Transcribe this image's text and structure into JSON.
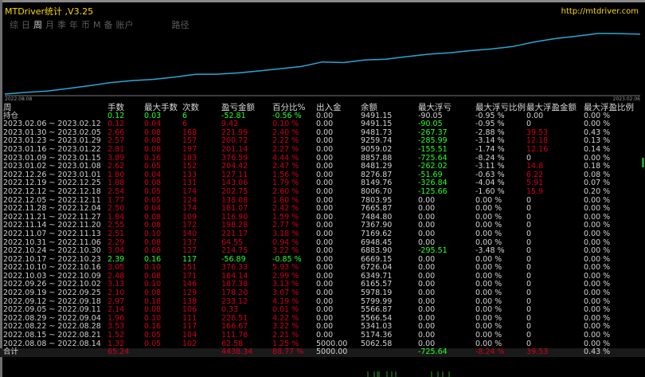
{
  "header": {
    "title": "MTDriver统计 ,V3.25",
    "url": "http://mtdriver.com"
  },
  "tabs": [
    {
      "label": "综",
      "selected": false
    },
    {
      "label": "日",
      "selected": false
    },
    {
      "label": "周",
      "selected": true
    },
    {
      "label": "月",
      "selected": false
    },
    {
      "label": "季",
      "selected": false
    },
    {
      "label": "年",
      "selected": false
    },
    {
      "label": "币",
      "selected": false
    },
    {
      "label": "M",
      "selected": false
    },
    {
      "label": "备",
      "selected": false
    },
    {
      "label": "账户",
      "selected": false
    },
    {
      "label": "路径",
      "selected": false
    }
  ],
  "chart_data": {
    "type": "line",
    "x_start_label": "2022.08.08",
    "x_end_label": "2023.02.06",
    "series": [
      {
        "values": [
          62.58,
          203.07,
          305.24,
          524.59,
          759.4,
          1015.48,
          1180.17,
          1282.75,
          1476.03,
          1709.15,
          1709.48,
          1815.48,
          1985.9,
          2172.57,
          2357.71,
          2734.04,
          2677.15,
          2891.9,
          2956.45,
          3177.62,
          3376.82,
          3493.72,
          3674.79,
          3812.88,
          4017.3,
          4394.89,
          4676.03,
          4876.75,
          5098.74,
          5093.99,
          5036.94
        ]
      }
    ],
    "color": "#2aa7d6",
    "grid": false
  },
  "table": {
    "columns": [
      "周",
      "手数",
      "最大手数",
      "次数",
      "盈亏金额",
      "百分比%",
      "出入金",
      "余额",
      "最大浮亏",
      "最大浮亏比例",
      "最大浮盈金额",
      "最大浮盈比例"
    ],
    "holding": {
      "label": "持仓",
      "lots": "0.12",
      "max_lots": "0.03",
      "count": "6",
      "pnl": "-52.81",
      "pct": "-0.56 %",
      "deposit": "0.00",
      "balance": "9491.15",
      "max_float_loss": "-90.05",
      "max_float_loss_pct": "-0.95 %",
      "max_float_profit": "0.00",
      "max_float_profit_pct": "0.00 %"
    },
    "rows": [
      {
        "week": "2023.02.06 ~ 2023.02.12",
        "lots": "0.12",
        "max_lots": "0.04",
        "count": "6",
        "pnl": "9.42",
        "pct": "0.10 %",
        "deposit": "0.00",
        "balance": "9491.15",
        "max_float_loss": "-90.05",
        "max_float_loss_pct": "-0.95 %",
        "max_float_profit": "0",
        "max_float_profit_pct": "0.00 %"
      },
      {
        "week": "2023.01.30 ~ 2023.02.05",
        "lots": "2.66",
        "max_lots": "0.08",
        "count": "168",
        "pnl": "221.99",
        "pct": "2.40 %",
        "deposit": "0.00",
        "balance": "9481.73",
        "max_float_loss": "-267.37",
        "max_float_loss_pct": "-2.88 %",
        "max_float_profit": "39.53",
        "max_float_profit_pct": "0.43 %"
      },
      {
        "week": "2023.01.23 ~ 2023.01.29",
        "lots": "2.57",
        "max_lots": "0.08",
        "count": "157",
        "pnl": "200.72",
        "pct": "2.22 %",
        "deposit": "0.00",
        "balance": "9259.74",
        "max_float_loss": "-285.99",
        "max_float_loss_pct": "-3.14 %",
        "max_float_profit": "12.18",
        "max_float_profit_pct": "0.13 %"
      },
      {
        "week": "2023.01.16 ~ 2023.01.22",
        "lots": "2.81",
        "max_lots": "0.08",
        "count": "197",
        "pnl": "201.14",
        "pct": "2.27 %",
        "deposit": "0.00",
        "balance": "9059.02",
        "max_float_loss": "-155.51",
        "max_float_loss_pct": "-1.74 %",
        "max_float_profit": "12.16",
        "max_float_profit_pct": "0.14 %"
      },
      {
        "week": "2023.01.09 ~ 2023.01.15",
        "lots": "3.89",
        "max_lots": "0.16",
        "count": "183",
        "pnl": "376.59",
        "pct": "4.44 %",
        "deposit": "0.00",
        "balance": "8857.88",
        "max_float_loss": "-725.64",
        "max_float_loss_pct": "-8.24 %",
        "max_float_profit": "0",
        "max_float_profit_pct": "0.00 %"
      },
      {
        "week": "2023.01.02 ~ 2023.01.08",
        "lots": "2.62",
        "max_lots": "0.05",
        "count": "152",
        "pnl": "204.42",
        "pct": "2.47 %",
        "deposit": "0.00",
        "balance": "8481.29",
        "max_float_loss": "-262.02",
        "max_float_loss_pct": "-3.11 %",
        "max_float_profit": "14.8",
        "max_float_profit_pct": "0.18 %"
      },
      {
        "week": "2022.12.26 ~ 2023.01.01",
        "lots": "1.80",
        "max_lots": "0.04",
        "count": "133",
        "pnl": "127.11",
        "pct": "1.56 %",
        "deposit": "0.00",
        "balance": "8276.87",
        "max_float_loss": "-51.69",
        "max_float_loss_pct": "-0.63 %",
        "max_float_profit": "6.22",
        "max_float_profit_pct": "0.08 %"
      },
      {
        "week": "2022.12.19 ~ 2022.12.25",
        "lots": "1.88",
        "max_lots": "0.08",
        "count": "131",
        "pnl": "143.06",
        "pct": "1.79 %",
        "deposit": "0.00",
        "balance": "8149.76",
        "max_float_loss": "-326.84",
        "max_float_loss_pct": "-4.04 %",
        "max_float_profit": "5.91",
        "max_float_profit_pct": "0.07 %"
      },
      {
        "week": "2022.12.12 ~ 2022.12.18",
        "lots": "2.54",
        "max_lots": "0.05",
        "count": "174",
        "pnl": "202.75",
        "pct": "2.60 %",
        "deposit": "0.00",
        "balance": "8006.70",
        "max_float_loss": "-125.66",
        "max_float_loss_pct": "-1.60 %",
        "max_float_profit": "15.9",
        "max_float_profit_pct": "0.20 %"
      },
      {
        "week": "2022.12.05 ~ 2022.12.11",
        "lots": "1.77",
        "max_lots": "0.05",
        "count": "124",
        "pnl": "138.08",
        "pct": "1.80 %",
        "deposit": "0.00",
        "balance": "7803.95",
        "max_float_loss": "0.00",
        "max_float_loss_pct": "0.00 %",
        "max_float_profit": "0",
        "max_float_profit_pct": "0.00 %"
      },
      {
        "week": "2022.11.28 ~ 2022.12.04",
        "lots": "2.50",
        "max_lots": "0.04",
        "count": "174",
        "pnl": "181.07",
        "pct": "2.42 %",
        "deposit": "0.00",
        "balance": "7665.87",
        "max_float_loss": "0.00",
        "max_float_loss_pct": "0.00 %",
        "max_float_profit": "0",
        "max_float_profit_pct": "0.00 %"
      },
      {
        "week": "2022.11.21 ~ 2022.11.27",
        "lots": "1.84",
        "max_lots": "0.08",
        "count": "109",
        "pnl": "116.90",
        "pct": "1.59 %",
        "deposit": "0.00",
        "balance": "7484.80",
        "max_float_loss": "0.00",
        "max_float_loss_pct": "0.00 %",
        "max_float_profit": "0",
        "max_float_profit_pct": "0.00 %"
      },
      {
        "week": "2022.11.14 ~ 2022.11.20",
        "lots": "2.55",
        "max_lots": "0.08",
        "count": "172",
        "pnl": "198.28",
        "pct": "2.77 %",
        "deposit": "0.00",
        "balance": "7367.90",
        "max_float_loss": "0.00",
        "max_float_loss_pct": "0.00 %",
        "max_float_profit": "0",
        "max_float_profit_pct": "0.00 %"
      },
      {
        "week": "2022.11.07 ~ 2022.11.13",
        "lots": "2.51",
        "max_lots": "0.10",
        "count": "140",
        "pnl": "221.17",
        "pct": "3.18 %",
        "deposit": "0.00",
        "balance": "7169.62",
        "max_float_loss": "0.00",
        "max_float_loss_pct": "0.00 %",
        "max_float_profit": "0",
        "max_float_profit_pct": "0.00 %"
      },
      {
        "week": "2022.10.31 ~ 2022.11.06",
        "lots": "2.29",
        "max_lots": "0.08",
        "count": "137",
        "pnl": "64.55",
        "pct": "0.94 %",
        "deposit": "0.00",
        "balance": "6948.45",
        "max_float_loss": "0.00",
        "max_float_loss_pct": "0.00 %",
        "max_float_profit": "0",
        "max_float_profit_pct": "0.00 %"
      },
      {
        "week": "2022.10.24 ~ 2022.10.30",
        "lots": "3.04",
        "max_lots": "0.08",
        "count": "127",
        "pnl": "214.75",
        "pct": "3.22 %",
        "deposit": "0.00",
        "balance": "6883.90",
        "max_float_loss": "-295.51",
        "max_float_loss_pct": "-3.48 %",
        "max_float_profit": "0",
        "max_float_profit_pct": "0.00 %"
      },
      {
        "week": "2022.10.17 ~ 2022.10.23",
        "lots": "2.39",
        "max_lots": "0.16",
        "count": "117",
        "pnl": "-56.89",
        "pct": "-0.85 %",
        "deposit": "0.00",
        "balance": "6669.15",
        "max_float_loss": "0.00",
        "max_float_loss_pct": "0.00 %",
        "max_float_profit": "0",
        "max_float_profit_pct": "0.00 %"
      },
      {
        "week": "2022.10.10 ~ 2022.10.16",
        "lots": "3.05",
        "max_lots": "0.10",
        "count": "151",
        "pnl": "376.33",
        "pct": "5.93 %",
        "deposit": "0.00",
        "balance": "6726.04",
        "max_float_loss": "0.00",
        "max_float_loss_pct": "0.00 %",
        "max_float_profit": "0",
        "max_float_profit_pct": "0.00 %"
      },
      {
        "week": "2022.10.03 ~ 2022.10.09",
        "lots": "2.48",
        "max_lots": "0.08",
        "count": "171",
        "pnl": "184.14",
        "pct": "2.99 %",
        "deposit": "0.00",
        "balance": "6349.71",
        "max_float_loss": "0.00",
        "max_float_loss_pct": "0.00 %",
        "max_float_profit": "0",
        "max_float_profit_pct": "0.00 %"
      },
      {
        "week": "2022.09.26 ~ 2022.10.02",
        "lots": "3.13",
        "max_lots": "0.10",
        "count": "146",
        "pnl": "187.38",
        "pct": "3.13 %",
        "deposit": "0.00",
        "balance": "6165.57",
        "max_float_loss": "0.00",
        "max_float_loss_pct": "0.00 %",
        "max_float_profit": "0",
        "max_float_profit_pct": "0.00 %"
      },
      {
        "week": "2022.09.19 ~ 2022.09.25",
        "lots": "2.10",
        "max_lots": "0.08",
        "count": "129",
        "pnl": "178.20",
        "pct": "3.07 %",
        "deposit": "0.00",
        "balance": "5978.19",
        "max_float_loss": "0.00",
        "max_float_loss_pct": "0.00 %",
        "max_float_profit": "0",
        "max_float_profit_pct": "0.00 %"
      },
      {
        "week": "2022.09.12 ~ 2022.09.18",
        "lots": "2.97",
        "max_lots": "0.18",
        "count": "138",
        "pnl": "233.12",
        "pct": "4.19 %",
        "deposit": "0.00",
        "balance": "5799.99",
        "max_float_loss": "0.00",
        "max_float_loss_pct": "0.00 %",
        "max_float_profit": "0",
        "max_float_profit_pct": "0.00 %"
      },
      {
        "week": "2022.09.05 ~ 2022.09.11",
        "lots": "2.14",
        "max_lots": "0.08",
        "count": "106",
        "pnl": "0.33",
        "pct": "0.01 %",
        "deposit": "0.00",
        "balance": "5566.87",
        "max_float_loss": "0.00",
        "max_float_loss_pct": "0.00 %",
        "max_float_profit": "0",
        "max_float_profit_pct": "0.00 %"
      },
      {
        "week": "2022.08.29 ~ 2022.09.04",
        "lots": "1.96",
        "max_lots": "0.10",
        "count": "111",
        "pnl": "226.51",
        "pct": "4.22 %",
        "deposit": "0.00",
        "balance": "5566.54",
        "max_float_loss": "0.00",
        "max_float_loss_pct": "0.00 %",
        "max_float_profit": "0",
        "max_float_profit_pct": "0.00 %"
      },
      {
        "week": "2022.08.22 ~ 2022.08.28",
        "lots": "3.53",
        "max_lots": "0.16",
        "count": "117",
        "pnl": "166.67",
        "pct": "3.22 %",
        "deposit": "0.00",
        "balance": "5341.03",
        "max_float_loss": "0.00",
        "max_float_loss_pct": "0.00 %",
        "max_float_profit": "0",
        "max_float_profit_pct": "0.00 %"
      },
      {
        "week": "2022.08.15 ~ 2022.08.21",
        "lots": "1.52",
        "max_lots": "0.05",
        "count": "104",
        "pnl": "111.78",
        "pct": "2.21 %",
        "deposit": "0.00",
        "balance": "5174.36",
        "max_float_loss": "0.00",
        "max_float_loss_pct": "0.00 %",
        "max_float_profit": "0",
        "max_float_profit_pct": "0.00 %"
      },
      {
        "week": "2022.08.08 ~ 2022.08.14",
        "lots": "1.32",
        "max_lots": "0.05",
        "count": "102",
        "pnl": "62.58",
        "pct": "1.25 %",
        "deposit": "5000.00",
        "balance": "5062.58",
        "max_float_loss": "0.00",
        "max_float_loss_pct": "0.00 %",
        "max_float_profit": "0",
        "max_float_profit_pct": "0.00 %"
      }
    ],
    "total": {
      "label": "合计",
      "lots": "65.24",
      "max_lots": "",
      "count": "",
      "pnl": "4438.34",
      "pct": "88.77 %",
      "deposit": "5000.00",
      "balance": "",
      "max_float_loss": "-725.64",
      "max_float_loss_pct": "-8.24 %",
      "max_float_profit": "39.53",
      "max_float_profit_pct": "0.43 %"
    }
  },
  "colors": {
    "background": "#000000",
    "title": "#ffd800",
    "profit": "#d0001c",
    "loss": "#28ff28",
    "neutral": "#d2d2d2",
    "chart_line": "#2aa7d6"
  }
}
